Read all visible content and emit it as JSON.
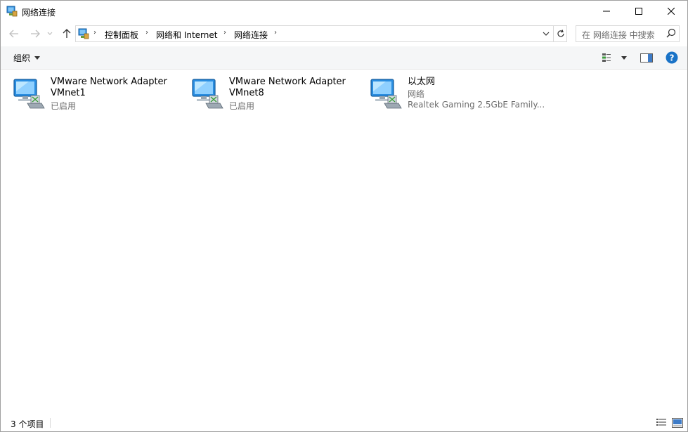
{
  "window": {
    "title": "网络连接"
  },
  "address": {
    "breadcrumbs": [
      "控制面板",
      "网络和 Internet",
      "网络连接"
    ],
    "search_placeholder": "在 网络连接 中搜索"
  },
  "command_bar": {
    "organize_label": "组织"
  },
  "items": [
    {
      "name": "VMware Network Adapter",
      "line2": "VMnet1",
      "status": "已启用"
    },
    {
      "name": "VMware Network Adapter",
      "line2": "VMnet8",
      "status": "已启用"
    },
    {
      "name": "以太网",
      "line2": "网络",
      "status": "Realtek Gaming 2.5GbE Family..."
    }
  ],
  "status_bar": {
    "item_count": "3 个项目"
  },
  "colors": {
    "help_blue": "#1a73c7",
    "monitor_blue": "#2a8de0"
  }
}
